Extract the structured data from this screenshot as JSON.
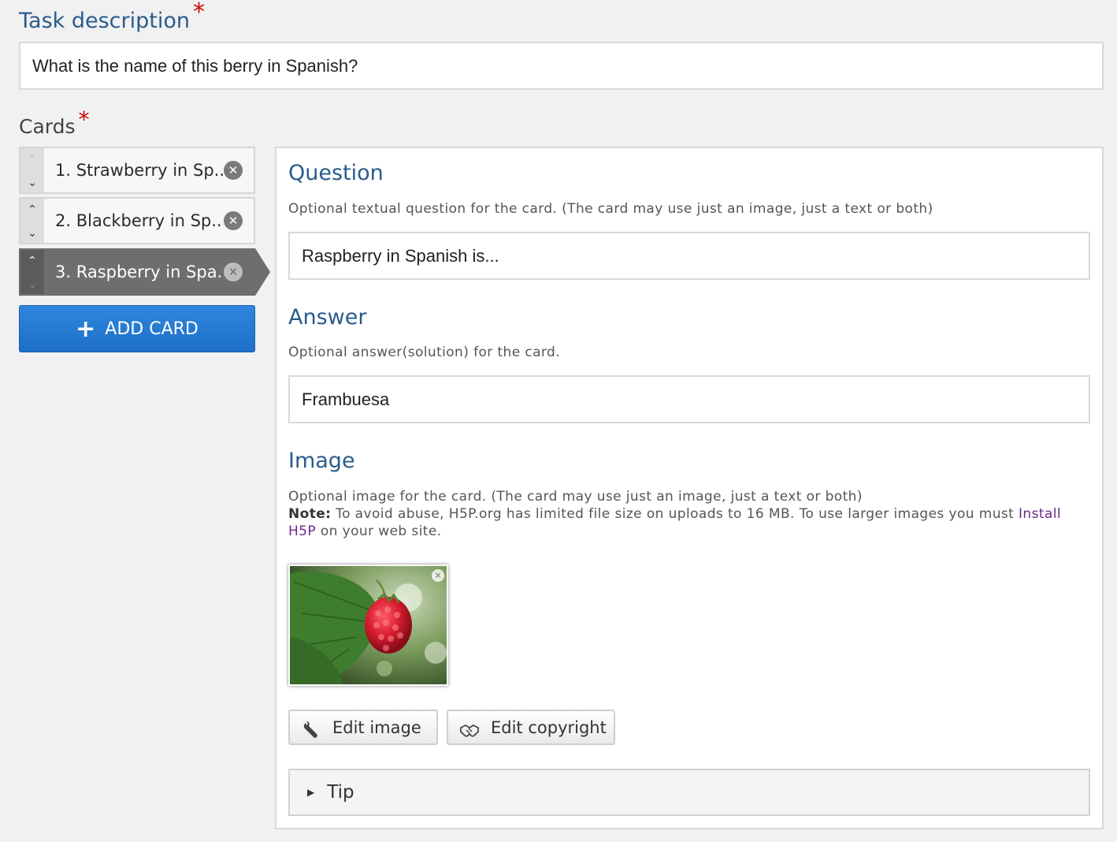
{
  "task": {
    "label": "Task description",
    "required_mark": "*",
    "value": "What is the name of this berry in Spanish?"
  },
  "cards": {
    "label": "Cards",
    "required_mark": "*",
    "items": [
      {
        "label": "1. Strawberry in Sp...",
        "selected": false
      },
      {
        "label": "2. Blackberry in Sp...",
        "selected": false
      },
      {
        "label": "3. Raspberry in Spa...",
        "selected": true
      }
    ],
    "add_label": "ADD CARD",
    "add_icon": "+"
  },
  "editor": {
    "question": {
      "title": "Question",
      "description": "Optional textual question for the card. (The card may use just an image, just a text or both)",
      "value": "Raspberry in Spanish is..."
    },
    "answer": {
      "title": "Answer",
      "description": "Optional answer(solution) for the card.",
      "value": "Frambuesa"
    },
    "image": {
      "title": "Image",
      "description": "Optional image for the card. (The card may use just an image, just a text or both)",
      "note_label": "Note:",
      "note_text": " To avoid abuse, H5P.org has limited file size on uploads to 16 MB. To use larger images you must ",
      "note_link": "Install H5P",
      "note_end": " on your web site.",
      "edit_image_label": "Edit image",
      "edit_copyright_label": "Edit copyright"
    },
    "tip": {
      "label": "Tip"
    }
  },
  "colors": {
    "accent_blue": "#2a5b8c",
    "required_red": "#cc0000",
    "add_button": "#1d6fc6",
    "selected_card": "#6e6e6e"
  }
}
